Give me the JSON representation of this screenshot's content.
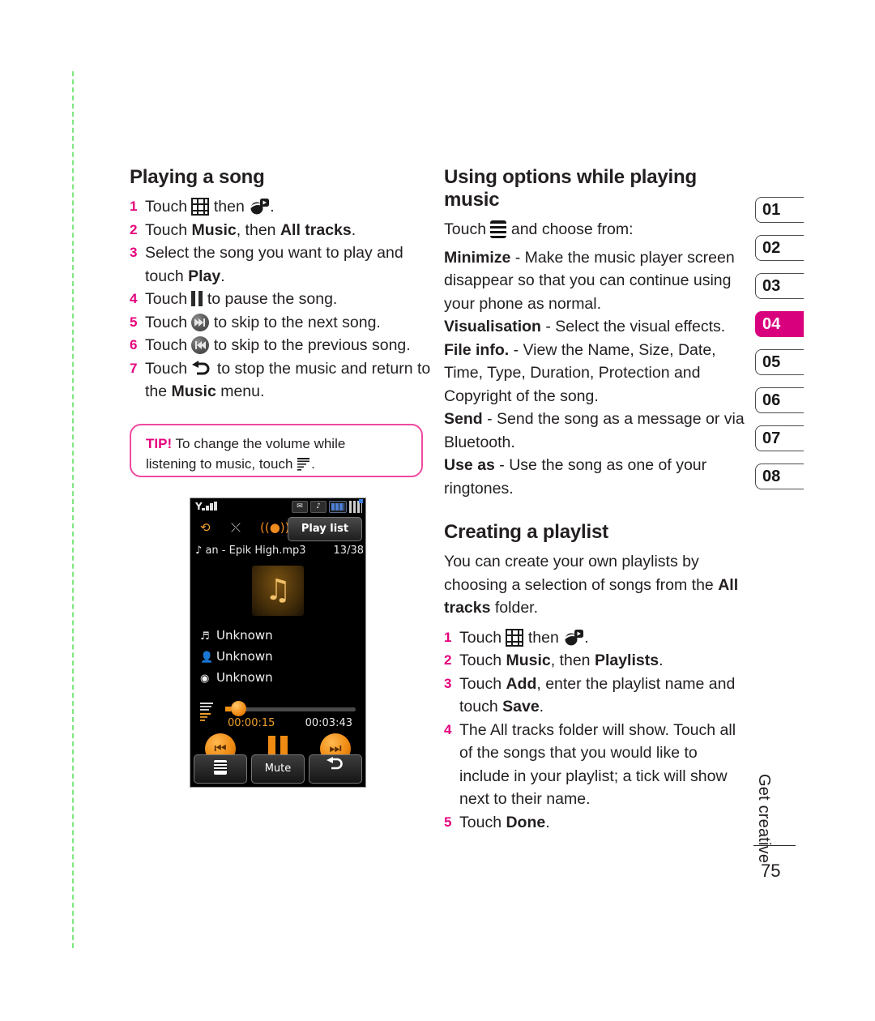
{
  "page": {
    "number": "75",
    "running_head": "Get creative"
  },
  "left_column": {
    "heading": "Playing a song",
    "steps": [
      {
        "num": "1",
        "pre": "Touch ",
        "icon1": "grid-icon",
        "mid": " then ",
        "icon2": "media-player-icon",
        "post": "."
      },
      {
        "num": "2",
        "text_parts": [
          "Touch ",
          "Music",
          ", then ",
          "All tracks",
          "."
        ]
      },
      {
        "num": "3",
        "text": "Select the song you want to play and touch ",
        "bold": "Play",
        "post": "."
      },
      {
        "num": "4",
        "pre": "Touch ",
        "icon": "pause-icon",
        "post": " to pause the song."
      },
      {
        "num": "5",
        "pre": "Touch ",
        "icon": "skip-next-icon",
        "post": " to skip to the next song."
      },
      {
        "num": "6",
        "pre": "Touch ",
        "icon": "skip-previous-icon",
        "post": " to skip to the previous song."
      },
      {
        "num": "7",
        "pre": "Touch ",
        "icon": "return-icon",
        "post": " to stop the music and return to the ",
        "bold": "Music",
        "tail": " menu."
      }
    ],
    "tip": {
      "label": "TIP!",
      "line1": " To change the volume while",
      "line2": "listening to music, touch ",
      "icon": "volume-equalizer-icon",
      "tail": "."
    }
  },
  "phone_screenshot": {
    "status": {
      "signal": "signal-bars-icon",
      "icons": [
        "message-icon",
        "music-note-icon",
        "battery-icon",
        "menu-grid-icon"
      ]
    },
    "modes": {
      "repeat": "repeat-one-icon",
      "shuffle": "shuffle-icon",
      "sound": "sound-effect-icon",
      "playlist_button": "Play list"
    },
    "track_title": "an - Epik High.mp3",
    "track_index": "13/38",
    "album_art": "music-note-art",
    "meta": [
      {
        "icon": "note-icon",
        "value": "Unknown"
      },
      {
        "icon": "artist-icon",
        "value": "Unknown"
      },
      {
        "icon": "album-icon",
        "value": "Unknown"
      }
    ],
    "time_current": "00:00:15",
    "time_total": "00:03:43",
    "controls": {
      "prev": "skip-previous-icon",
      "pause": "pause-icon",
      "next": "skip-next-icon"
    },
    "softkeys": {
      "left": "options-menu-icon",
      "center": "Mute",
      "right": "back-icon"
    }
  },
  "right_column": {
    "heading_options": "Using options while playing music",
    "options_intro_pre": "Touch ",
    "options_intro_icon": "options-menu-icon",
    "options_intro_post": " and choose from:",
    "options": [
      {
        "term": "Minimize",
        "desc": " - Make the music player screen disappear so that you can continue using your phone as normal."
      },
      {
        "term": "Visualisation",
        "desc": " - Select the visual effects."
      },
      {
        "term": "File info.",
        "desc": " - View the Name, Size, Date, Time, Type, Duration, Protection and Copyright of the song."
      },
      {
        "term": "Send",
        "desc": " - Send the song as a message or via Bluetooth."
      },
      {
        "term": "Use as",
        "desc": " - Use the song as one of your ringtones."
      }
    ],
    "heading_playlist": "Creating a playlist",
    "playlist_intro_a": "You can create your own playlists by choosing a selection of songs from the ",
    "playlist_intro_bold": "All tracks",
    "playlist_intro_b": " folder.",
    "playlist_steps": [
      {
        "num": "1",
        "pre": "Touch ",
        "icon1": "grid-icon",
        "mid": " then ",
        "icon2": "media-player-icon",
        "post": "."
      },
      {
        "num": "2",
        "parts": [
          "Touch ",
          "Music",
          ", then ",
          "Playlists",
          "."
        ]
      },
      {
        "num": "3",
        "pre": "Touch ",
        "bold": "Add",
        "mid": ", enter the playlist name and touch ",
        "bold2": "Save",
        "post": "."
      },
      {
        "num": "4",
        "text": "The All tracks folder will show. Touch all of the songs that you would like to include in your playlist; a tick will show next to their name."
      },
      {
        "num": "5",
        "pre": "Touch ",
        "bold": "Done",
        "post": "."
      }
    ]
  },
  "tabs": [
    {
      "label": "01",
      "active": false
    },
    {
      "label": "02",
      "active": false
    },
    {
      "label": "03",
      "active": false
    },
    {
      "label": "04",
      "active": true
    },
    {
      "label": "05",
      "active": false
    },
    {
      "label": "06",
      "active": false
    },
    {
      "label": "07",
      "active": false
    },
    {
      "label": "08",
      "active": false
    }
  ],
  "colors": {
    "accent_magenta": "#e5007d",
    "tab_active": "#d9007e",
    "tip_border": "#ef4aa0",
    "dash_green": "#7ee87e"
  }
}
